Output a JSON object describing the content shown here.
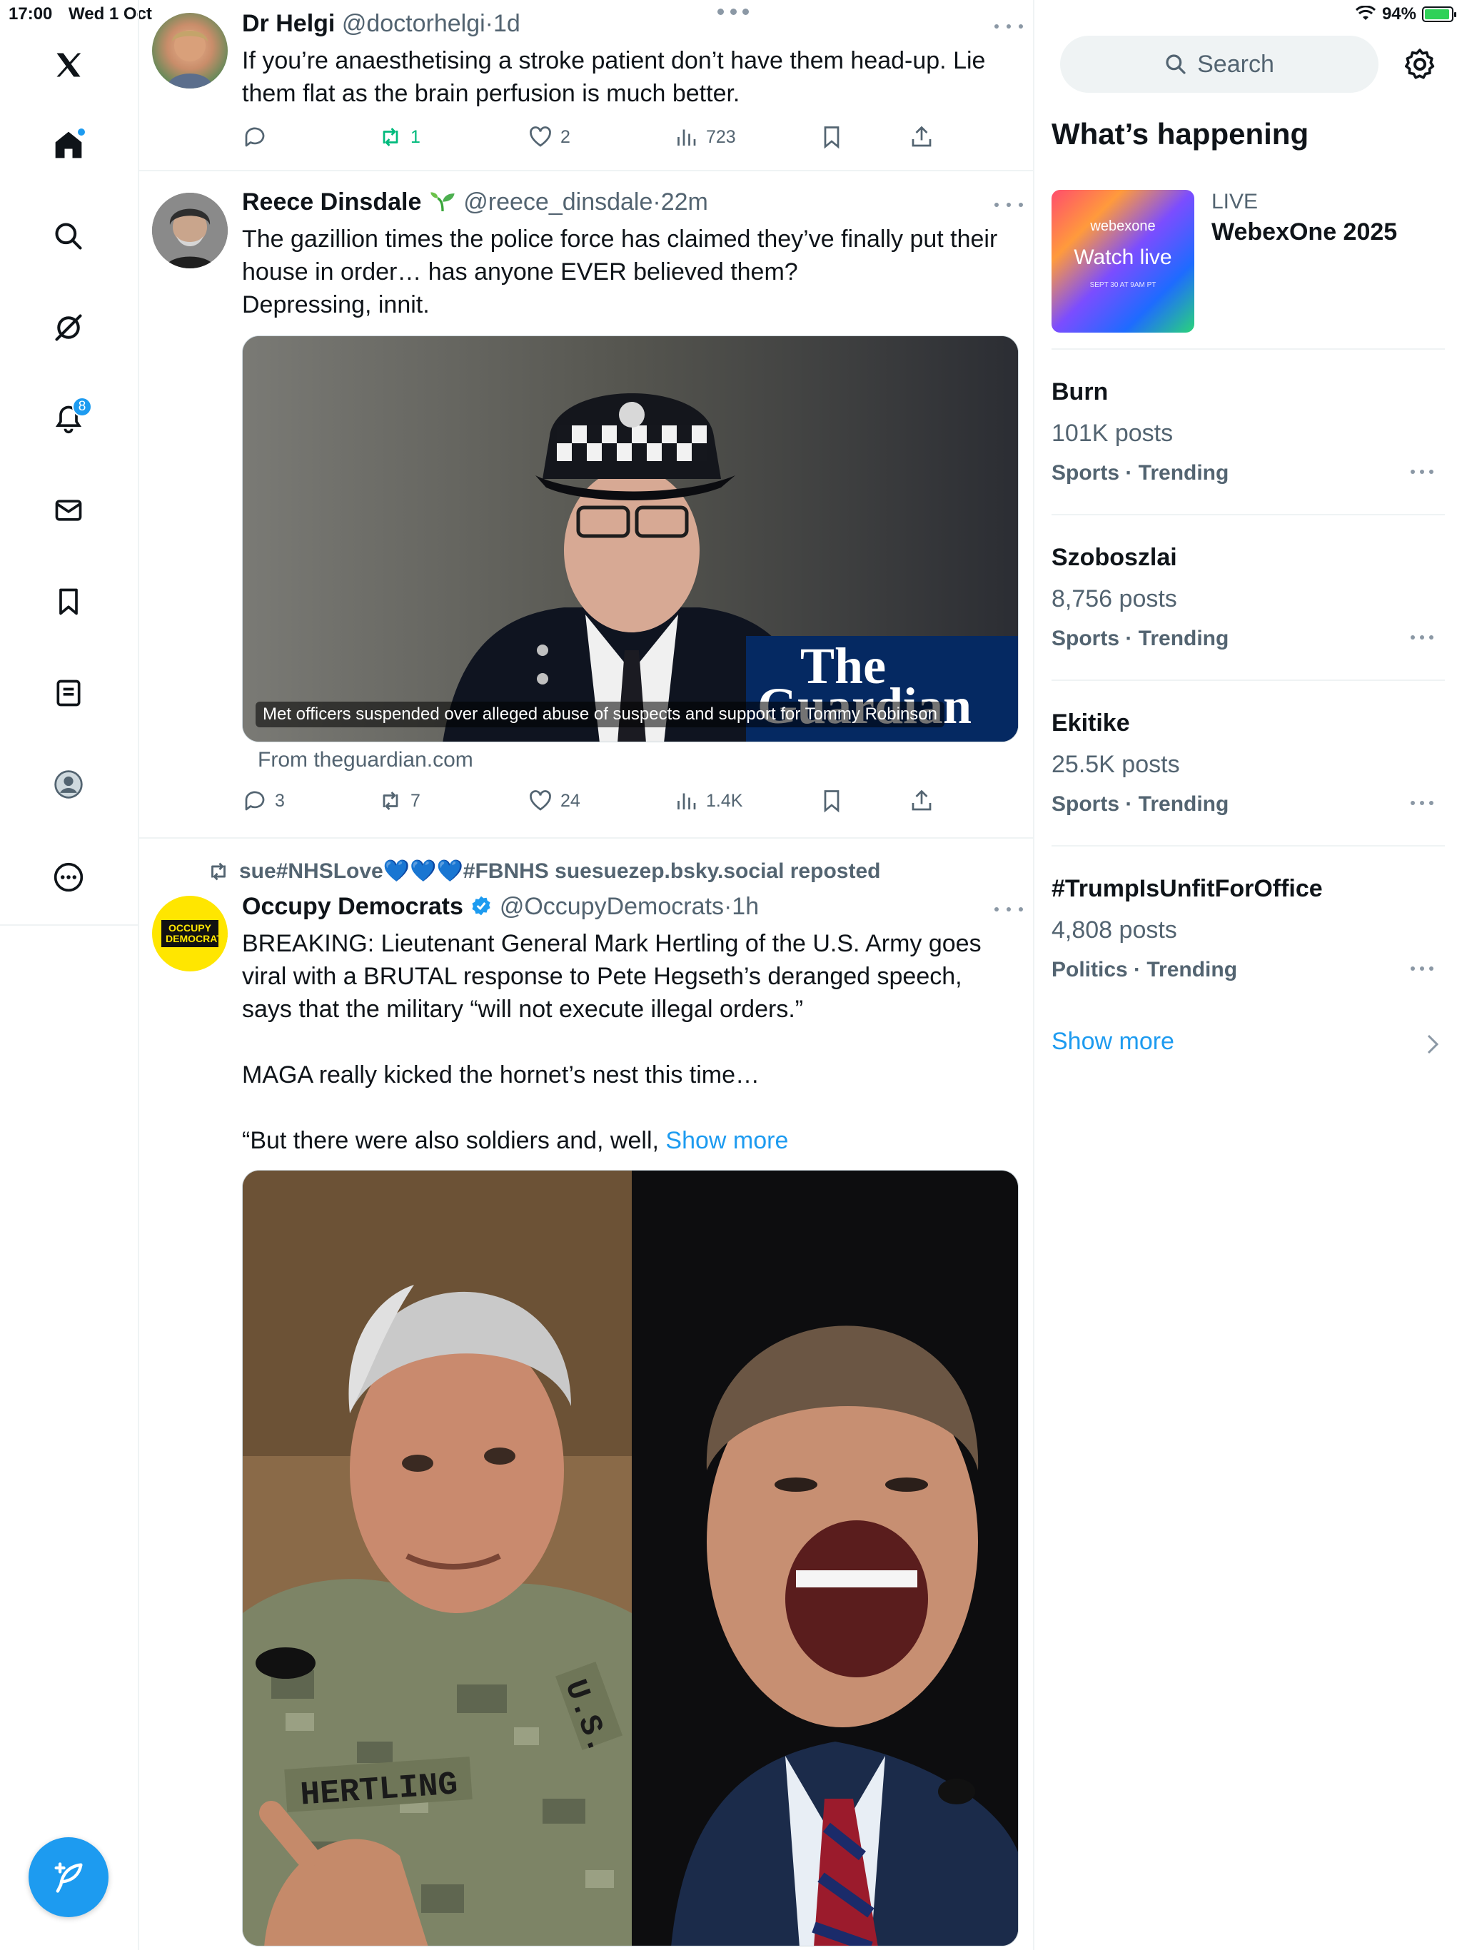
{
  "status": {
    "time": "17:00",
    "date": "Wed 1 Oct",
    "battery": "94%",
    "battery_level": 0.94
  },
  "nav": {
    "notifications_badge": "8"
  },
  "tweets": [
    {
      "name": "Dr Helgi",
      "handle": "@doctorhelgi",
      "time": "1d",
      "text": "If you’re anaesthetising a stroke patient don’t have them head-up. Lie them flat as the brain perfusion is much better.",
      "stats": {
        "reply": "",
        "repost": "1",
        "like": "2",
        "views": "723"
      }
    },
    {
      "name": "Reece Dinsdale",
      "handle": "@reece_dinsdale",
      "time": "22m",
      "text": "The gazillion times the police force has claimed they’ve finally put their house in order… has anyone EVER believed them?\nDepressing, innit.",
      "card": {
        "caption": "Met officers suspended over alleged abuse of suspects and support for Tommy Robinson",
        "logo_line1": "The",
        "logo_line2": "Guardian",
        "from": "From theguardian.com"
      },
      "stats": {
        "reply": "3",
        "repost": "7",
        "like": "24",
        "views": "1.4K"
      }
    },
    {
      "reposted_by": "sue#NHSLove💙💙💙#FBNHS suesuezep.bsky.social reposted",
      "name": "Occupy Democrats",
      "handle": "@OccupyDemocrats",
      "time": "1h",
      "avatar_text": "OCCUPY DEMOCRATS",
      "text": "BREAKING: Lieutenant General Mark Hertling of the U.S. Army goes viral with a BRUTAL response to Pete Hegseth’s deranged speech, says that the military “will not execute illegal orders.”\n\nMAGA  really kicked the hornet’s nest this time…\n\n“But there were also soldiers and, well,",
      "show_more": "Show more",
      "image_text": {
        "nametape": "HERTLING",
        "branch": "U.S."
      }
    }
  ],
  "sidebar": {
    "search_placeholder": "Search",
    "section_title": "What’s happening",
    "live": {
      "label": "LIVE",
      "title": "WebexOne 2025",
      "thumb_brand": "webexone",
      "thumb_cta": "Watch live",
      "thumb_date": "SEPT 30 AT 9AM PT"
    },
    "trends": [
      {
        "title": "Burn",
        "posts": "101K posts",
        "category": "Sports · Trending"
      },
      {
        "title": "Szoboszlai",
        "posts": "8,756 posts",
        "category": "Sports · Trending"
      },
      {
        "title": "Ekitike",
        "posts": "25.5K posts",
        "category": "Sports · Trending"
      },
      {
        "title": "#TrumpIsUnfitForOffice",
        "posts": "4,808 posts",
        "category": "Politics · Trending"
      }
    ],
    "show_more": "Show more"
  },
  "colors": {
    "accent": "#1d9bf0",
    "repost_green": "#00ba7c",
    "secondary_text": "#536471"
  }
}
